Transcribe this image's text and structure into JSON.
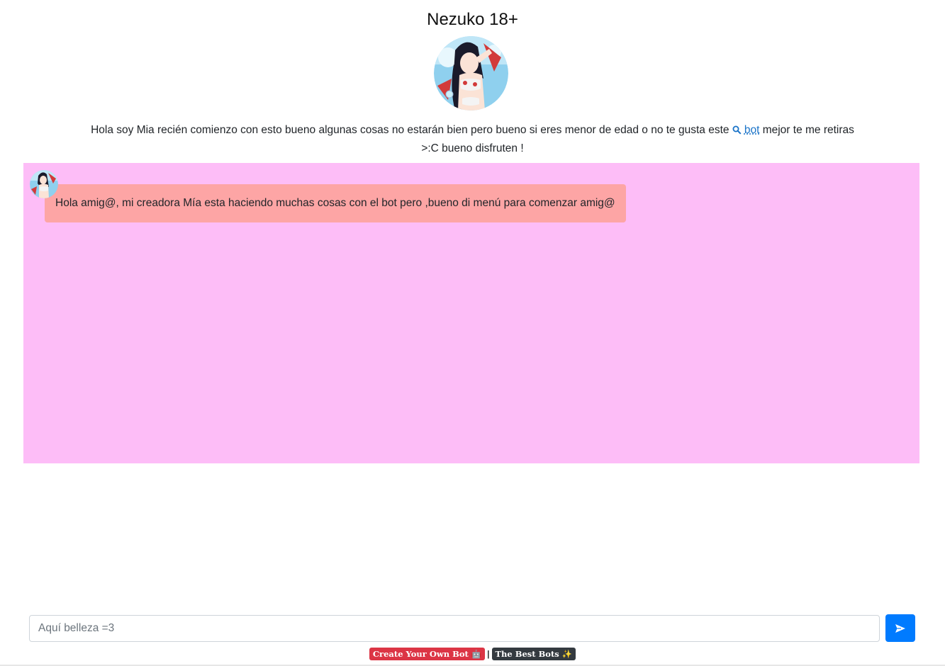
{
  "header": {
    "title": "Nezuko 18+"
  },
  "description": {
    "text_before": "Hola soy Mia recién comienzo con esto bueno algunas cosas no estarán bien pero bueno si eres menor de edad o no te gusta este ",
    "link_text": "bot",
    "text_after": " mejor te me retiras >:C bueno disfruten !"
  },
  "chat": {
    "background_color": "#fdbdf7",
    "bubble_color": "#fda5a5",
    "messages": [
      {
        "sender": "bot",
        "text": "Hola amig@, mi creadora Mía esta haciendo muchas cosas con el bot pero ,bueno di menú para comenzar amig@"
      }
    ]
  },
  "composer": {
    "placeholder": "Aquí belleza =3",
    "value": "",
    "send_icon": "send-icon",
    "accent_color": "#007bff"
  },
  "footer": {
    "create_label": "Create Your Own Bot 🤖",
    "separator": "|",
    "best_label": "The Best Bots ✨"
  }
}
